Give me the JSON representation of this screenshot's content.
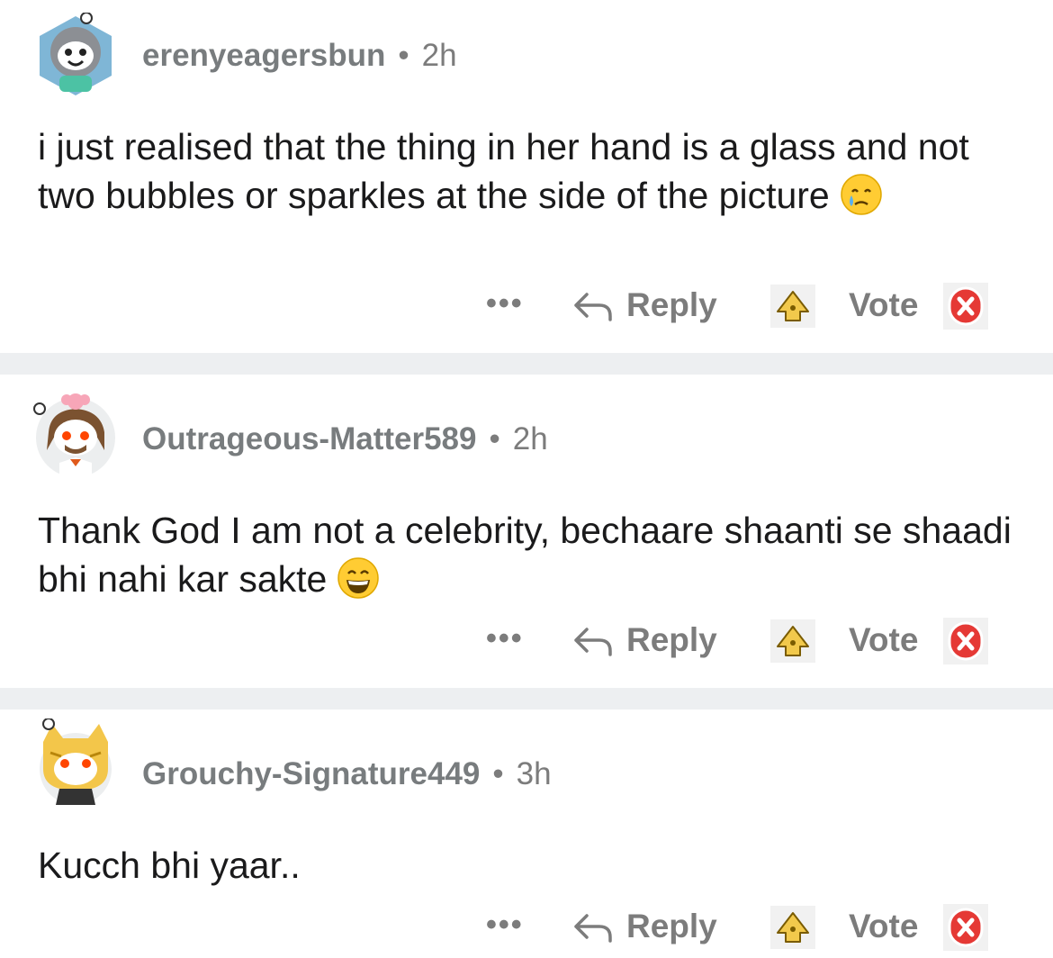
{
  "comments": [
    {
      "author": "erenyeagersbun",
      "separator": "•",
      "time": "2h",
      "text": "i just realised that the thing in her hand is a glass and not two bubbles or sparkles at the side of the picture",
      "emoji": "crying-face-emoji",
      "actions": {
        "more": "•••",
        "reply": "Reply",
        "vote": "Vote"
      }
    },
    {
      "author": "Outrageous-Matter589",
      "separator": "•",
      "time": "2h",
      "text": "Thank God I am not a celebrity, bechaare shaanti se shaadi bhi nahi kar sakte",
      "emoji": "grinning-face-emoji",
      "actions": {
        "more": "•••",
        "reply": "Reply",
        "vote": "Vote"
      }
    },
    {
      "author": "Grouchy-Signature449",
      "separator": "•",
      "time": "3h",
      "text": "Kucch bhi yaar..",
      "emoji": "",
      "actions": {
        "more": "•••",
        "reply": "Reply",
        "vote": "Vote"
      }
    }
  ],
  "colors": {
    "meta_text": "#7c7c7c",
    "separator_band": "#edeff1",
    "upvote_icon": "#f2c94c",
    "downvote_icon": "#e53935"
  }
}
